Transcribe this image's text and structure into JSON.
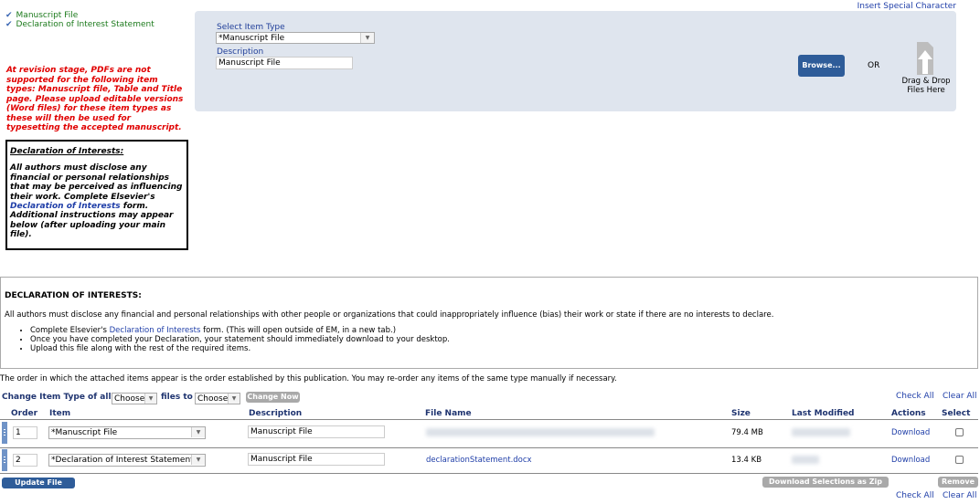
{
  "required_items": {
    "items": [
      "Manuscript File",
      "Declaration of Interest Statement"
    ]
  },
  "insert_special_character": "Insert Special Character",
  "warning": "At revision stage, PDFs are not supported for the following item types: Manuscript file, Table and Title page. Please upload editable versions (Word files) for these item types as these will then be used for typesetting the accepted manuscript.",
  "doi_box": {
    "title": "Declaration of Interests:",
    "text_before": "All authors must disclose any financial or personal relationships that may be perceived as influencing their work. Complete Elsevier's ",
    "link": "Declaration of Interests",
    "text_after": " form. Additional instructions may appear below (after uploading your main file)."
  },
  "upload": {
    "select_label": "Select Item Type",
    "select_value": "*Manuscript File",
    "description_label": "Description",
    "description_value": "Manuscript File",
    "browse": "Browse...",
    "or": "OR",
    "drag_drop": "Drag & Drop",
    "files_here": "Files Here"
  },
  "doi_panel": {
    "title": "DECLARATION OF INTERESTS:",
    "intro": "All authors must disclose any financial and personal relationships with other people or organizations that could inappropriately influence (bias) their work or state if there are no interests to declare.",
    "bullet1_before": "Complete Elsevier's ",
    "bullet1_link": "Declaration of Interests",
    "bullet1_after": " form. (This will open outside of EM, in a new tab.)",
    "bullet2": "Once you have completed your Declaration, your statement should immediately download to your desktop.",
    "bullet3": "Upload this file along with the rest of the required items."
  },
  "order_note": "The order in which the attached items appear is the order established by this publication. You may re-order any items of the same type manually if necessary.",
  "change_bar": {
    "label1": "Change Item Type of all",
    "select1": "Choose",
    "label2": "files to",
    "select2": "Choose",
    "button": "Change Now"
  },
  "check_all": "Check All",
  "clear_all": "Clear All",
  "table": {
    "headers": {
      "order": "Order",
      "item": "Item",
      "description": "Description",
      "file_name": "File Name",
      "size": "Size",
      "last_modified": "Last Modified",
      "actions": "Actions",
      "select": "Select"
    },
    "rows": [
      {
        "order": "1",
        "item": "*Manuscript File",
        "description": "Manuscript File",
        "file_name": "",
        "size": "79.4 MB",
        "last_modified": "",
        "action": "Download"
      },
      {
        "order": "2",
        "item": "*Declaration of Interest Statement",
        "description": "Manuscript File",
        "file_name": "declarationStatement.docx",
        "size": "13.4 KB",
        "last_modified": "",
        "action": "Download"
      }
    ]
  },
  "update_file_order": "Update File Order",
  "download_zip": "Download Selections as Zip File",
  "remove": "Remove",
  "colors": {
    "accent": "#2e5c99",
    "link": "#1f3ea8",
    "warning": "#e00000",
    "check": "#3a66b3"
  }
}
